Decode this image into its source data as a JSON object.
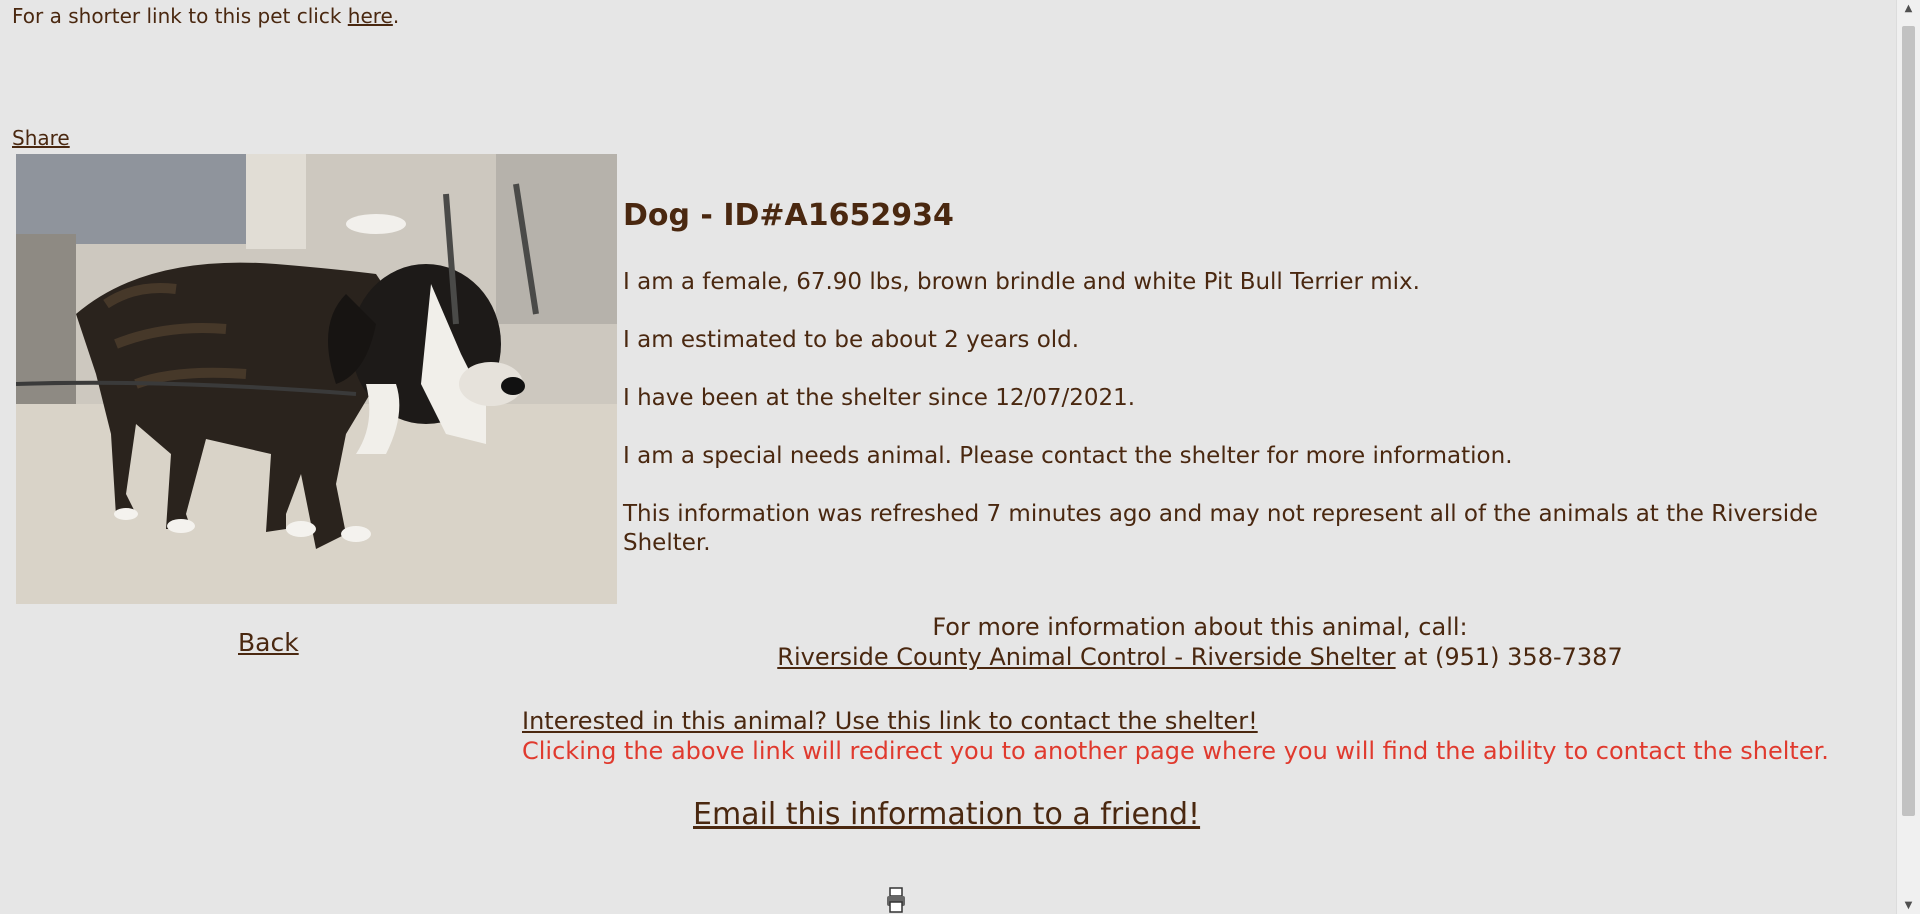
{
  "top": {
    "short_link_text": "For a shorter link to this pet click",
    "short_link_anchor": "here",
    "short_link_end": ".",
    "share": "Share"
  },
  "pet": {
    "title": "Dog - ID#A1652934",
    "description": "I am a female, 67.90 lbs, brown brindle and white Pit Bull Terrier mix.",
    "age": "I am estimated to be about 2 years old.",
    "since": "I have been at the shelter since 12/07/2021.",
    "special_needs": "I am a special needs animal. Please contact the shelter for more information.",
    "refresh_note": "This information was refreshed 7 minutes ago and may not represent all of the animals at the Riverside Shelter."
  },
  "nav": {
    "back": "Back"
  },
  "contact": {
    "more_info": "For more information about this animal, call:",
    "shelter_link": "Riverside County Animal Control - Riverside Shelter",
    "phone_text": "at (951) 358-7387",
    "interested_link": "Interested in this animal? Use this link to contact the shelter!",
    "redirect_note": "Clicking the above link will redirect you to another page where you will find the ability to contact the shelter.",
    "email_link": "Email this information to a friend!"
  },
  "colors": {
    "background": "#e6e6e6",
    "text": "#4a2810",
    "warning": "#e03a2e"
  },
  "icons": {
    "scroll_up": "triangle-up-icon",
    "scroll_down": "triangle-down-icon",
    "loading": "printer-icon"
  }
}
